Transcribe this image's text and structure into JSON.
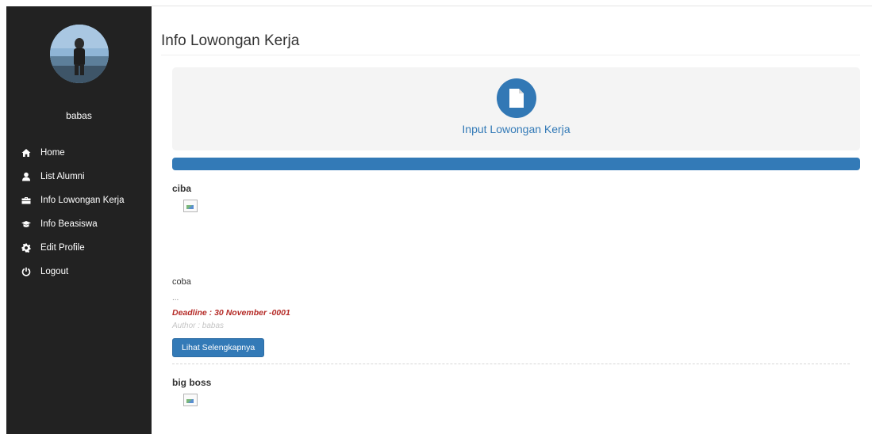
{
  "sidebar": {
    "username": "babas",
    "items": [
      {
        "label": "Home",
        "icon": "home-icon"
      },
      {
        "label": "List Alumni",
        "icon": "user-icon"
      },
      {
        "label": "Info Lowongan Kerja",
        "icon": "briefcase-icon"
      },
      {
        "label": "Info Beasiswa",
        "icon": "graduation-cap-icon"
      },
      {
        "label": "Edit Profile",
        "icon": "gear-icon"
      },
      {
        "label": "Logout",
        "icon": "power-icon"
      }
    ]
  },
  "main": {
    "title": "Info Lowongan Kerja",
    "input_link": "Input Lowongan Kerja",
    "posts": [
      {
        "title": "ciba",
        "body": "coba",
        "ellipsis": "...",
        "deadline": "Deadline : 30 November -0001",
        "author": "Author : babas",
        "button": "Lihat Selengkapnya"
      },
      {
        "title": "big boss"
      }
    ]
  },
  "colors": {
    "sidebar_bg": "#222222",
    "primary": "#337ab7",
    "deadline": "#b52b27"
  }
}
